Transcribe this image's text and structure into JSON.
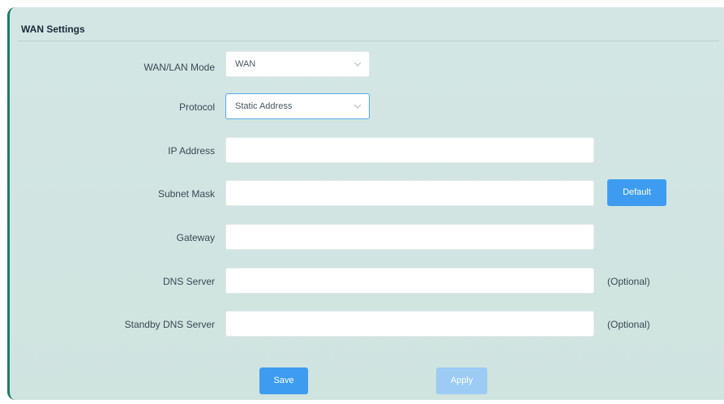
{
  "panel": {
    "title": "WAN Settings"
  },
  "form": {
    "wan_lan_mode": {
      "label": "WAN/LAN Mode",
      "value": "WAN"
    },
    "protocol": {
      "label": "Protocol",
      "value": "Static Address"
    },
    "ip_address": {
      "label": "IP Address",
      "value": ""
    },
    "subnet_mask": {
      "label": "Subnet Mask",
      "value": ""
    },
    "gateway": {
      "label": "Gateway",
      "value": ""
    },
    "dns_server": {
      "label": "DNS Server",
      "value": "",
      "note": "(Optional)"
    },
    "standby_dns_server": {
      "label": "Standby DNS Server",
      "value": "",
      "note": "(Optional)"
    }
  },
  "buttons": {
    "default_label": "Default",
    "save_label": "Save",
    "apply_label": "Apply"
  },
  "icons": {
    "select_arrow": "chevron-down-icon"
  },
  "colors": {
    "panel_background": "#d3e6e4",
    "accent_border": "#1f7a6a",
    "primary_button": "#3d9cf0",
    "disabled_button": "#9ccbf4",
    "focused_border": "#58a8e8"
  }
}
